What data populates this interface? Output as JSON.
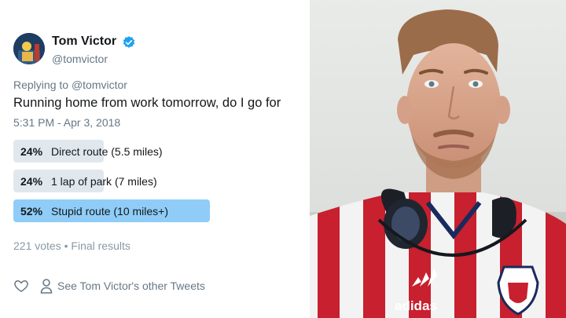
{
  "tweet": {
    "display_name": "Tom Victor",
    "handle": "@tomvictor",
    "replying_prefix": "Replying to",
    "replying_handle": "@tomvictor",
    "text": "Running home from work tomorrow, do I go for",
    "timestamp": "5:31 PM - Apr 3, 2018",
    "verified_icon": "verified-badge-icon",
    "accent_color": "#1da1f2"
  },
  "poll": {
    "options": [
      {
        "percent": "24%",
        "label": "Direct route (5.5 miles)",
        "share": 0.24,
        "winner": false
      },
      {
        "percent": "24%",
        "label": "1 lap of park (7 miles)",
        "share": 0.24,
        "winner": false
      },
      {
        "percent": "52%",
        "label": "Stupid route (10 miles+)",
        "share": 0.52,
        "winner": true
      }
    ],
    "votes": "221 votes",
    "separator": "•",
    "status": "Final results",
    "bar_color": "#e1e8ed",
    "winner_color": "#8fcdf8"
  },
  "actions": {
    "like_icon": "heart-icon",
    "profile_icon": "person-icon",
    "see_more": "See Tom Victor's other Tweets"
  },
  "photo": {
    "description_icon": "selfie-photo",
    "jersey_logo_text": "adidas"
  }
}
